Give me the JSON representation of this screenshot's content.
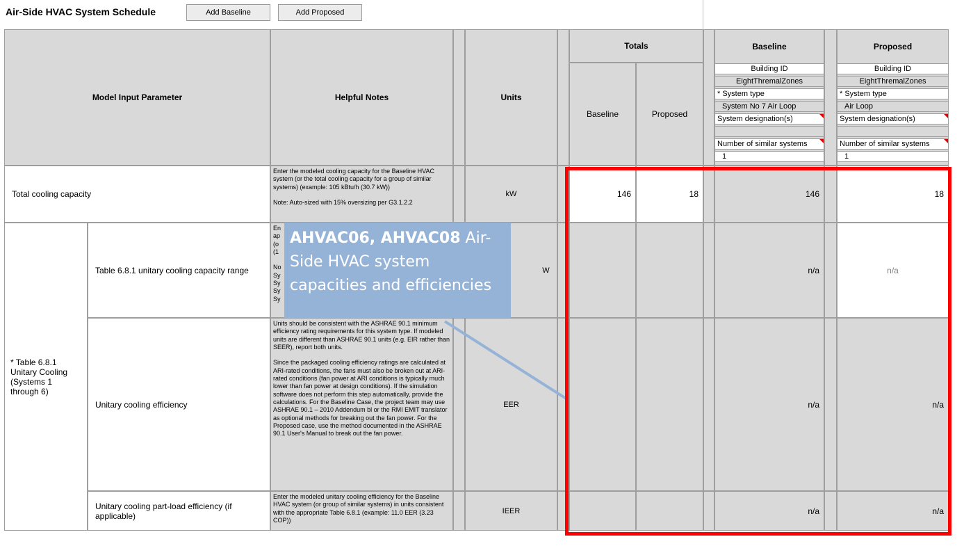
{
  "header": {
    "title": "Air-Side HVAC System Schedule",
    "add_baseline": "Add Baseline",
    "add_proposed": "Add Proposed"
  },
  "columns": {
    "model_input": "Model Input Parameter",
    "helpful_notes": "Helpful Notes",
    "units": "Units",
    "totals": "Totals",
    "totals_baseline": "Baseline",
    "totals_proposed": "Proposed",
    "baseline": "Baseline",
    "proposed": "Proposed"
  },
  "baseline_info": {
    "building_id_label": "Building ID",
    "building_id": "EightThremalZones",
    "system_type_label": "* System type",
    "system_type": "System No 7 Air Loop",
    "designation_label": "System designation(s)",
    "designation": "",
    "similar_label": "Number of similar systems",
    "similar": "1"
  },
  "proposed_info": {
    "building_id_label": "Building ID",
    "building_id": "EightThremalZones",
    "system_type_label": "* System type",
    "system_type": "Air Loop",
    "designation_label": "System designation(s)",
    "designation": "",
    "similar_label": "Number of similar systems",
    "similar": "1"
  },
  "rows": {
    "cooling_capacity": {
      "param": "Total cooling capacity",
      "notes": "Enter the modeled cooling capacity for the Baseline HVAC system (or the total cooling capacity for a group of similar systems) (example: 105 kBtu/h (30.7 kW))\n\nNote: Auto-sized with 15% oversizing per G3.1.2.2",
      "units": "kW",
      "totals_baseline": "146",
      "totals_proposed": "18",
      "baseline": "146",
      "proposed": "18"
    },
    "group_label": "* Table 6.8.1 Unitary Cooling (Systems 1 through 6)",
    "unitary_range": {
      "param": "Table 6.8.1 unitary cooling capacity range",
      "notes": "En\nap\n(o\n(1\n\nNo\nSy\nSy\nSy\nSy",
      "units": "W",
      "baseline": "n/a",
      "proposed": "n/a"
    },
    "unitary_efficiency": {
      "param": "Unitary cooling efficiency",
      "notes": "Units should be consistent with the ASHRAE 90.1 minimum efficiency rating requirements for this system type. If modeled units are different than ASHRAE 90.1 units (e.g. EIR rather than SEER), report both units.\n\nSince the packaged cooling efficiency ratings are calculated at ARI-rated conditions, the fans must also be broken out at ARI-rated conditions (fan power at ARI conditions is typically much lower than fan power at design conditions).  If the simulation software does not perform this step automatically, provide the calculations. For the Baseline Case, the project team may use ASHRAE 90.1 – 2010 Addendum bl or the RMI EMIT translator as optional methods for breaking out the fan power. For the Proposed case, use the method documented in the ASHRAE 90.1 User's Manual to break out the fan power.",
      "units": "EER",
      "baseline": "n/a",
      "proposed": "n/a"
    },
    "part_load": {
      "param": "Unitary cooling part-load efficiency (if applicable)",
      "notes": "Enter the modeled unitary cooling efficiency for the Baseline HVAC system (or group of similar systems) in units consistent with the appropriate Table 6.8.1 (example: 11.0 EER (3.23 COP))",
      "units": "IEER",
      "baseline": "n/a",
      "proposed": "n/a"
    }
  },
  "callout": {
    "bold": "AHVAC06, AHVAC08",
    "text": " Air-Side HVAC system capacities and efficiencies"
  },
  "colors": {
    "callout_bg": "#95b3d7",
    "highlight": "#ff0000",
    "header_grey": "#d9d9d9"
  }
}
